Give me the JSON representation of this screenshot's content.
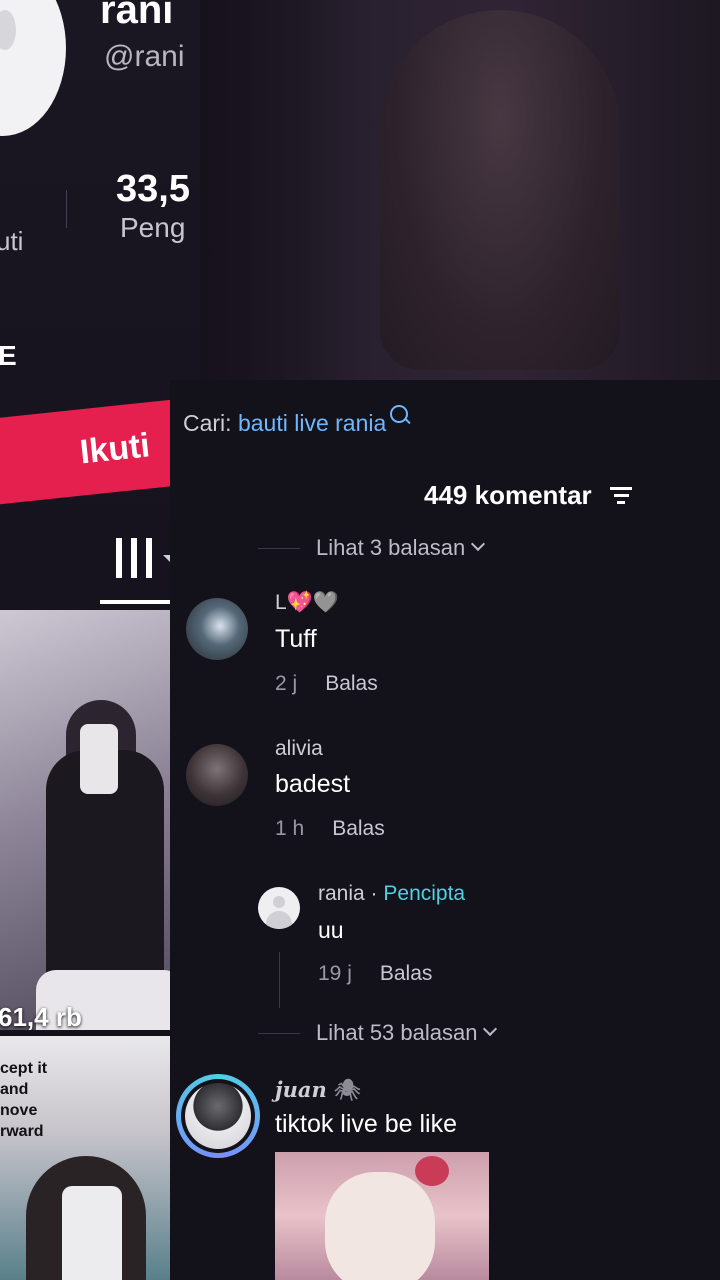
{
  "profile": {
    "name": "rani",
    "handle": "@rani",
    "stat_number": "33,5",
    "stat_label": "Peng",
    "stat_left_label": "uti",
    "bio_fragment": "E",
    "follow_button": "Ikuti",
    "videos": [
      {
        "views": "61,4 rb"
      },
      {
        "caption": "cept it\nand\nnove\nrward"
      }
    ]
  },
  "comments_panel": {
    "search_prefix": "Cari:",
    "search_query": "bauti live rania",
    "count_label": "449 komentar",
    "view_replies_top": "Lihat 3 balasan",
    "comments": [
      {
        "user": "L💖🩶",
        "text": "Tuff",
        "time": "2 j",
        "reply": "Balas"
      },
      {
        "user": "alivia",
        "text": "badest",
        "time": "1 h",
        "reply": "Balas"
      }
    ],
    "nested_reply": {
      "user": "rania",
      "separator": "·",
      "badge": "Pencipta",
      "text": "uu",
      "time": "19 j",
      "reply": "Balas"
    },
    "view_replies_bottom": "Lihat 53 balasan",
    "last_comment": {
      "user": "juan",
      "user_emoji": "🕷",
      "text": "tiktok live be like"
    }
  },
  "colors": {
    "follow": "#e5204f",
    "link": "#6fb7ff",
    "creator": "#4fd1e3",
    "sheet_bg": "#131119"
  }
}
